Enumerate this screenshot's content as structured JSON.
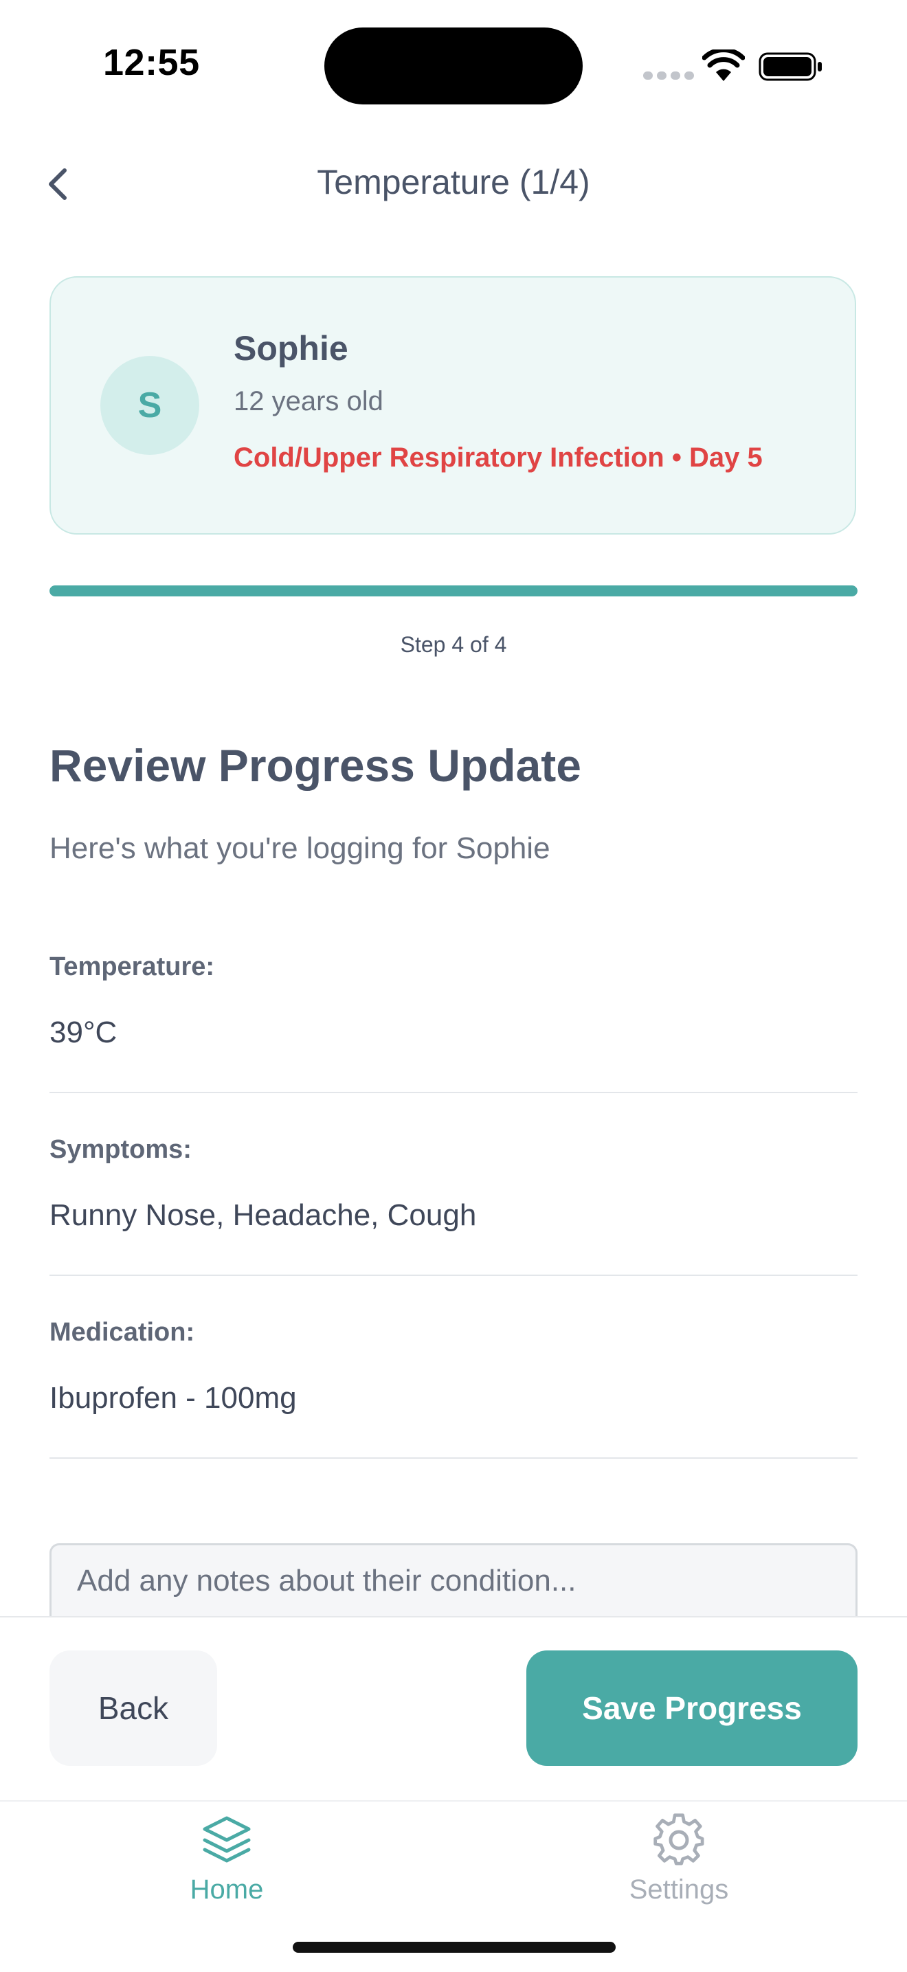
{
  "status_bar": {
    "time": "12:55"
  },
  "header": {
    "title": "Temperature (1/4)"
  },
  "patient": {
    "initial": "S",
    "name": "Sophie",
    "age": "12 years old",
    "condition": "Cold/Upper Respiratory Infection • Day 5"
  },
  "progress": {
    "fraction": 1.0,
    "step_label": "Step 4 of 4"
  },
  "review": {
    "title": "Review Progress Update",
    "subtitle": "Here's what you're logging for Sophie",
    "fields": [
      {
        "label": "Temperature:",
        "value": "39°C"
      },
      {
        "label": "Symptoms:",
        "value": "Runny Nose, Headache, Cough"
      },
      {
        "label": "Medication:",
        "value": "Ibuprofen - 100mg"
      }
    ]
  },
  "notes": {
    "placeholder": "Add any notes about their condition..."
  },
  "actions": {
    "back_label": "Back",
    "save_label": "Save Progress"
  },
  "tabs": [
    {
      "label": "Home",
      "icon": "layers-icon",
      "active": true
    },
    {
      "label": "Settings",
      "icon": "gear-icon",
      "active": false
    }
  ],
  "colors": {
    "accent": "#4aaaa5",
    "alert": "#e04444",
    "inactive": "#a8aeb7"
  }
}
